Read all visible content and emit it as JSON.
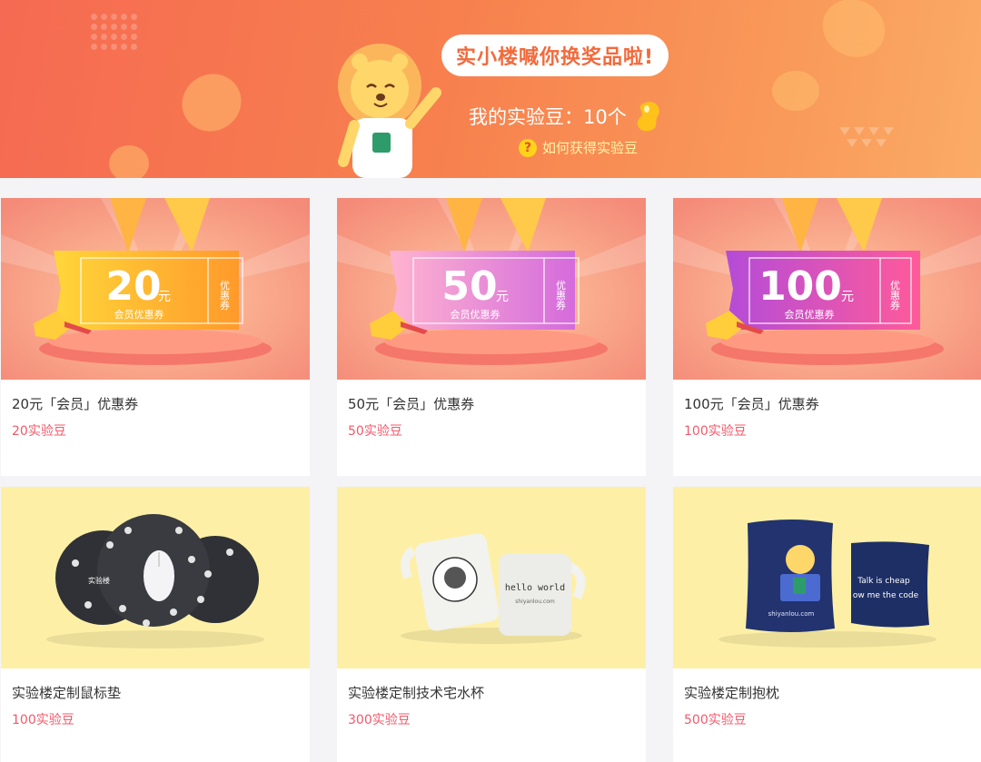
{
  "banner": {
    "speech": "实小楼喊你换奖品啦!",
    "beans_label": "我的实验豆：10个",
    "howto_label": "如何获得实验豆",
    "howto_icon": "question-icon",
    "colors": {
      "accent": "#f36a3c",
      "bean": "#ffc21a"
    }
  },
  "products": [
    {
      "title": "20元「会员」优惠券",
      "price": "20实验豆",
      "coupon": {
        "amount": "20",
        "unit": "元",
        "sub": "会员优惠券",
        "tag": "优惠券"
      }
    },
    {
      "title": "50元「会员」优惠券",
      "price": "50实验豆",
      "coupon": {
        "amount": "50",
        "unit": "元",
        "sub": "会员优惠券",
        "tag": "优惠券"
      }
    },
    {
      "title": "100元「会员」优惠券",
      "price": "100实验豆",
      "coupon": {
        "amount": "100",
        "unit": "元",
        "sub": "会员优惠券",
        "tag": "优惠券"
      }
    },
    {
      "title": "实验楼定制鼠标垫",
      "price": "100实验豆",
      "product_text": {
        "logo": "实验楼"
      }
    },
    {
      "title": "实验楼定制技术宅水杯",
      "price": "300实验豆",
      "product_text": {
        "mug": "hello world",
        "mug_url": "shiyanlou.com"
      }
    },
    {
      "title": "实验楼定制抱枕",
      "price": "500实验豆",
      "product_text": {
        "pillow_url": "shiyanlou.com",
        "pillow_slogan_1": "Talk is cheap",
        "pillow_slogan_2": "ow me the code"
      }
    }
  ],
  "colors": {
    "price": "#f2596a",
    "title": "#333333",
    "product_bg": "#fdf0a6"
  }
}
